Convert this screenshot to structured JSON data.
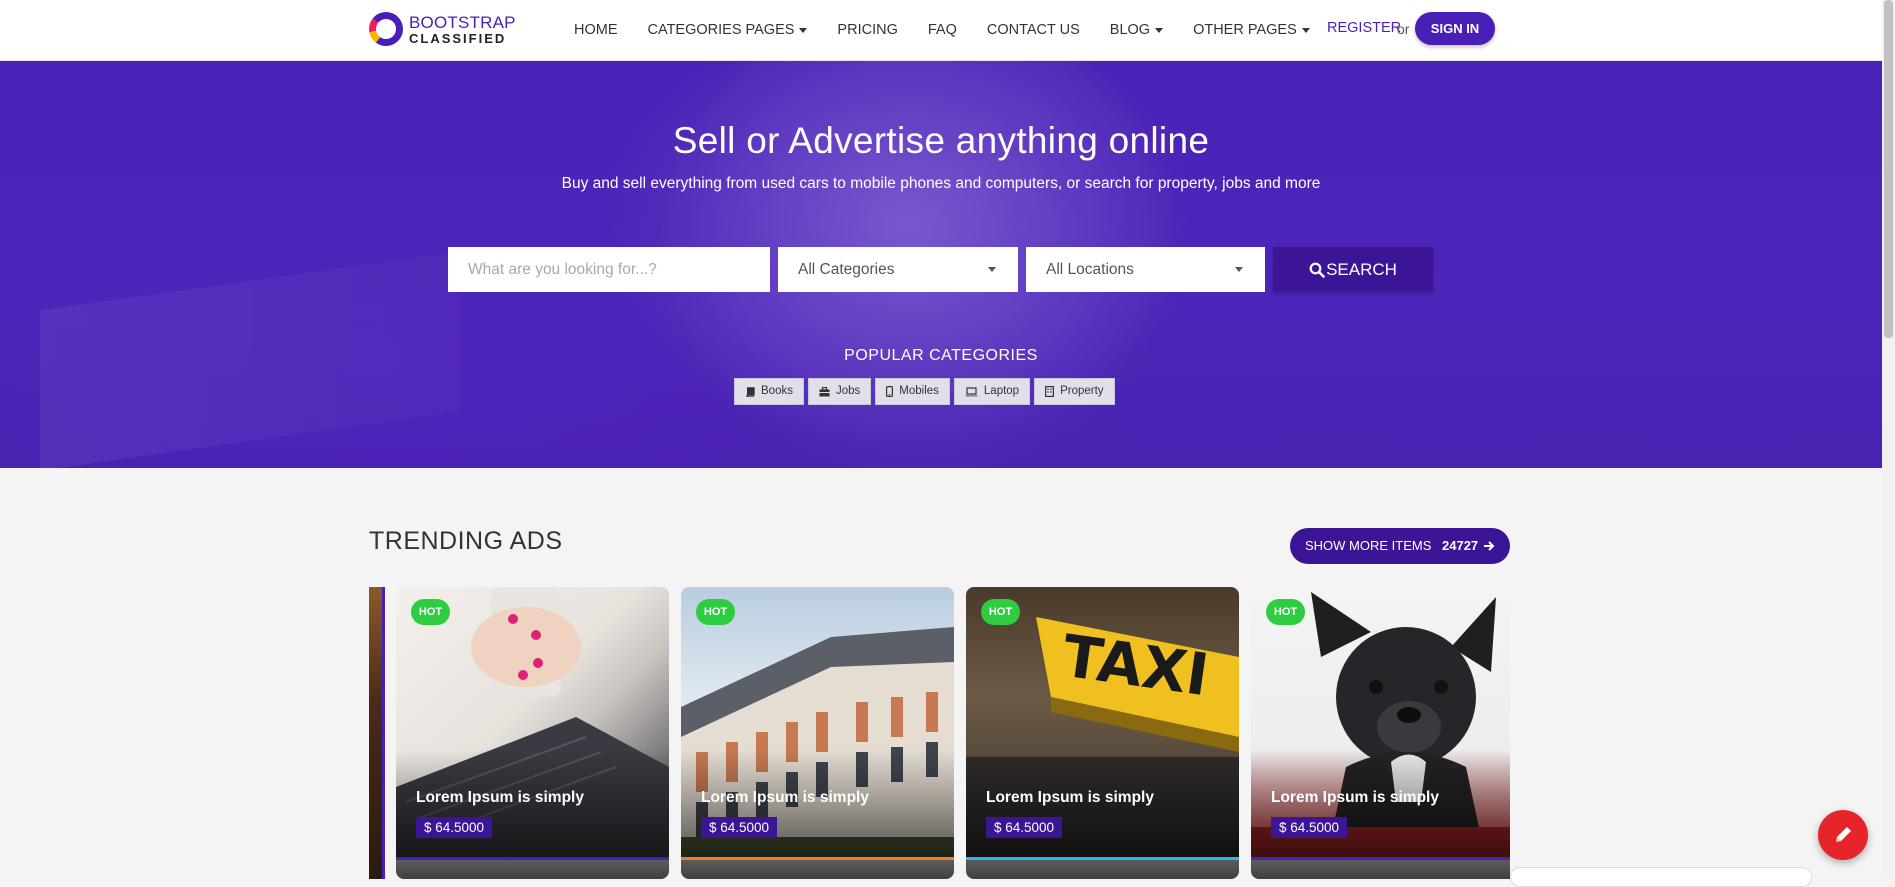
{
  "brand": {
    "line1": "BOOTSTRAP",
    "line2": "CLASSIFIED"
  },
  "nav": {
    "items": [
      {
        "label": "HOME",
        "dropdown": false
      },
      {
        "label": "CATEGORIES PAGES",
        "dropdown": true
      },
      {
        "label": "PRICING",
        "dropdown": false
      },
      {
        "label": "FAQ",
        "dropdown": false
      },
      {
        "label": "CONTACT US",
        "dropdown": false
      },
      {
        "label": "BLOG",
        "dropdown": true
      },
      {
        "label": "OTHER PAGES",
        "dropdown": true
      }
    ],
    "register": "REGISTER",
    "or": "or",
    "signin": "SIGN IN"
  },
  "hero": {
    "title": "Sell or Advertise anything online",
    "subtitle": "Buy and sell everything from used cars to mobile phones and computers, or search for property, jobs and more"
  },
  "search": {
    "placeholder": "What are you looking for...?",
    "category": "All Categories",
    "location": "All Locations",
    "button": "SEARCH"
  },
  "popular": {
    "title": "POPULAR CATEGORIES",
    "items": [
      {
        "label": "Books",
        "icon": "book-icon"
      },
      {
        "label": "Jobs",
        "icon": "briefcase-icon"
      },
      {
        "label": "Mobiles",
        "icon": "mobile-icon"
      },
      {
        "label": "Laptop",
        "icon": "laptop-icon"
      },
      {
        "label": "Property",
        "icon": "building-icon"
      }
    ]
  },
  "trending": {
    "title": "TRENDING ADS",
    "show_more": "SHOW MORE ITEMS",
    "count": "24727"
  },
  "ads": [
    {
      "badge": "HOT",
      "name": "Lorem Ipsum is simply",
      "price": "$ 64.5000",
      "image": "laptop-hands",
      "accent": "#4a1fb8"
    },
    {
      "badge": "HOT",
      "name": "Lorem Ipsum is simply",
      "price": "$ 64.5000",
      "image": "building",
      "accent": "#f57c22"
    },
    {
      "badge": "HOT",
      "name": "Lorem Ipsum is simply",
      "price": "$ 64.5000",
      "image": "taxi-sign",
      "accent": "#29b6f6"
    },
    {
      "badge": "HOT",
      "name": "Lorem Ipsum is simply",
      "price": "$ 64.5000",
      "image": "bulldog",
      "accent": "#4a1fb8"
    }
  ],
  "colors": {
    "primary": "#4a1fb8",
    "dark": "#3c1596",
    "hot": "#2ecc40",
    "fab": "#e5252a"
  }
}
